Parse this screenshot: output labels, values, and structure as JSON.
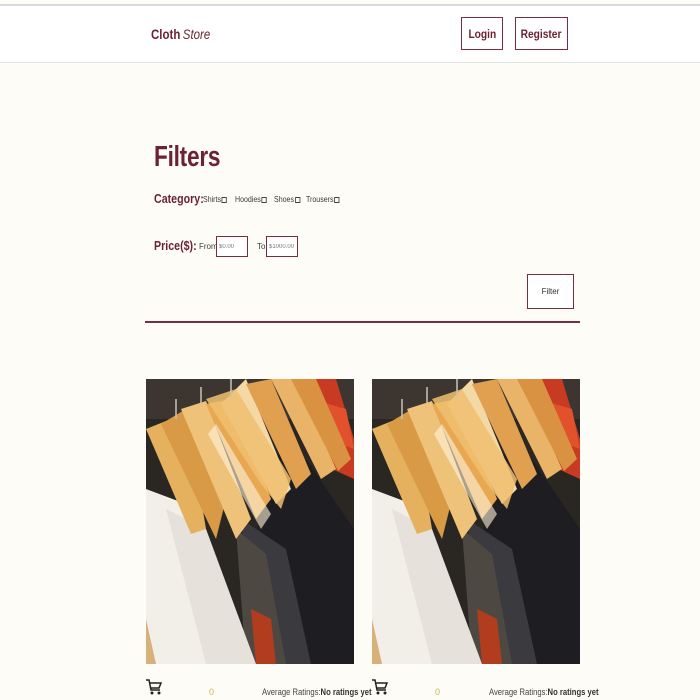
{
  "navbar": {
    "brand_bold": "Cloth",
    "brand_italic": "Store",
    "login_label": "Login",
    "register_label": "Register"
  },
  "filters": {
    "title": "Filters",
    "category_label": "Category:",
    "categories": [
      {
        "label": "Shirts",
        "checked": false
      },
      {
        "label": "Hoodies",
        "checked": false
      },
      {
        "label": "Shoes",
        "checked": false
      },
      {
        "label": "Trousers",
        "checked": false
      }
    ],
    "price_label": "Price($):",
    "from_label": "From",
    "from_placeholder": "$0.00",
    "to_label": "To",
    "to_placeholder": "$1000.00",
    "filter_button": "Filter"
  },
  "products": [
    {
      "image": "clothes-on-hangers",
      "rating_count": "0",
      "avg_label": "Average Ratings:",
      "avg_value": "No ratings yet",
      "cart_icon": "shopping-cart-icon"
    },
    {
      "image": "clothes-on-hangers",
      "rating_count": "0",
      "avg_label": "Average Ratings:",
      "avg_value": "No ratings yet",
      "cart_icon": "shopping-cart-icon"
    }
  ],
  "colors": {
    "accent": "#6b2333",
    "background": "#fdfcf7",
    "rating": "#c8b94a"
  }
}
